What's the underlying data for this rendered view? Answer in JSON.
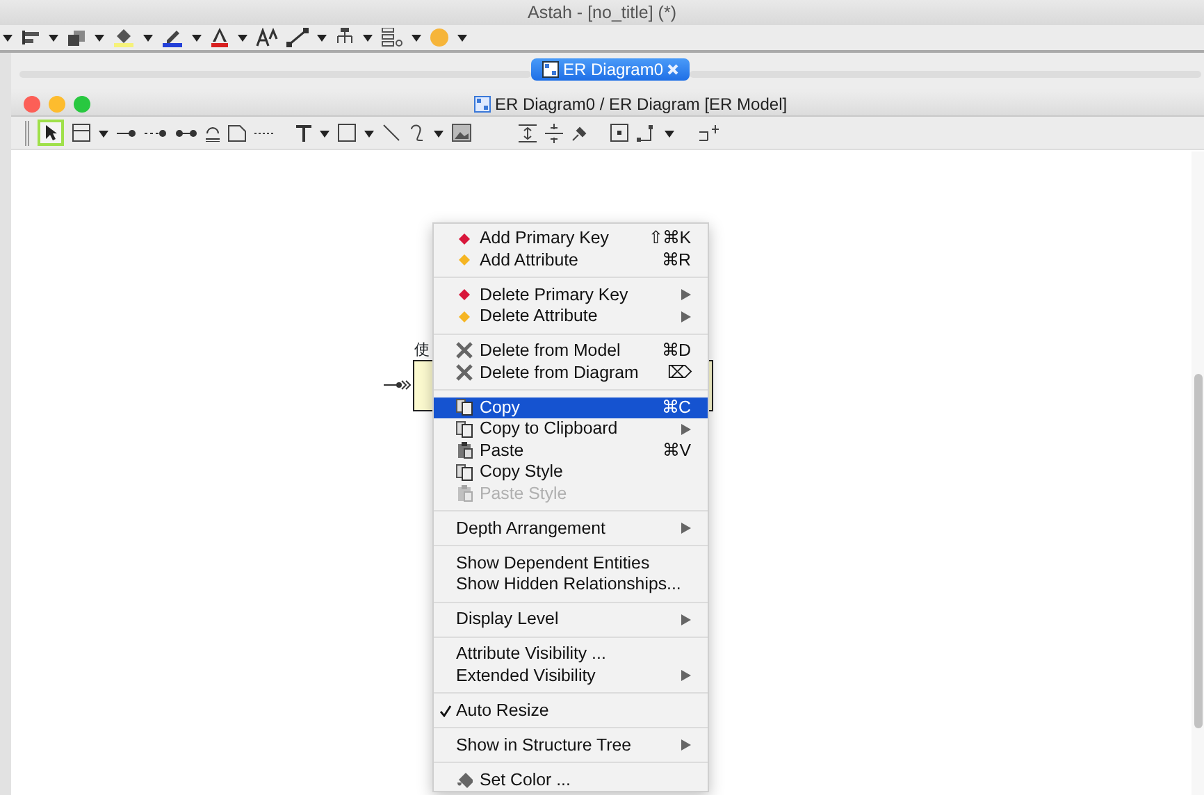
{
  "window": {
    "title": "Astah - [no_title] (*)"
  },
  "tabs": [
    {
      "label": "ER Diagram0",
      "selected": true
    }
  ],
  "diagram_window": {
    "title": "ER Diagram0 / ER Diagram [ER Model]"
  },
  "canvas": {
    "entity": {
      "label": "使"
    }
  },
  "context_menu": {
    "sections": [
      [
        {
          "label": "Add Primary Key",
          "kind": "primary-key",
          "shortcut": "⇧⌘K",
          "submenu": false,
          "selected": false,
          "disabled": false,
          "checked": false
        },
        {
          "label": "Add Attribute",
          "kind": "attribute",
          "shortcut": "⌘R",
          "submenu": false,
          "selected": false,
          "disabled": false,
          "checked": false
        }
      ],
      [
        {
          "label": "Delete Primary Key",
          "kind": "primary-key",
          "submenu": true,
          "selected": false,
          "disabled": false,
          "checked": false
        },
        {
          "label": "Delete Attribute",
          "kind": "attribute",
          "submenu": true,
          "selected": false,
          "disabled": false,
          "checked": false
        }
      ],
      [
        {
          "label": "Delete from Model",
          "kind": "delete",
          "shortcut": "⌘D",
          "submenu": false,
          "selected": false,
          "disabled": false,
          "checked": false
        },
        {
          "label": "Delete from Diagram",
          "kind": "delete",
          "shortcut": "⌦",
          "submenu": false,
          "selected": false,
          "disabled": false,
          "checked": false
        }
      ],
      [
        {
          "label": "Copy",
          "kind": "copy",
          "shortcut": "⌘C",
          "submenu": false,
          "selected": true,
          "disabled": false,
          "checked": false
        },
        {
          "label": "Copy to Clipboard",
          "kind": "copy",
          "submenu": true,
          "selected": false,
          "disabled": false,
          "checked": false
        },
        {
          "label": "Paste",
          "kind": "paste",
          "shortcut": "⌘V",
          "submenu": false,
          "selected": false,
          "disabled": false,
          "checked": false
        },
        {
          "label": "Copy Style",
          "kind": "copy",
          "submenu": false,
          "selected": false,
          "disabled": false,
          "checked": false
        },
        {
          "label": "Paste Style",
          "kind": "paste",
          "submenu": false,
          "selected": false,
          "disabled": true,
          "checked": false
        }
      ],
      [
        {
          "label": "Depth Arrangement",
          "kind": "plain",
          "submenu": true,
          "selected": false,
          "disabled": false,
          "checked": false
        }
      ],
      [
        {
          "label": "Show Dependent Entities",
          "kind": "plain",
          "submenu": false,
          "selected": false,
          "disabled": false,
          "checked": false
        },
        {
          "label": "Show Hidden Relationships...",
          "kind": "plain",
          "submenu": false,
          "selected": false,
          "disabled": false,
          "checked": false
        }
      ],
      [
        {
          "label": "Display Level",
          "kind": "plain",
          "submenu": true,
          "selected": false,
          "disabled": false,
          "checked": false
        }
      ],
      [
        {
          "label": "Attribute Visibility ...",
          "kind": "plain",
          "submenu": false,
          "selected": false,
          "disabled": false,
          "checked": false
        },
        {
          "label": "Extended Visibility",
          "kind": "plain",
          "submenu": true,
          "selected": false,
          "disabled": false,
          "checked": false
        }
      ],
      [
        {
          "label": "Auto Resize",
          "kind": "plain",
          "submenu": false,
          "selected": false,
          "disabled": false,
          "checked": true
        }
      ],
      [
        {
          "label": "Show in Structure Tree",
          "kind": "plain",
          "submenu": true,
          "selected": false,
          "disabled": false,
          "checked": false
        }
      ],
      [
        {
          "label": "Set Color ...",
          "kind": "paint",
          "submenu": false,
          "selected": false,
          "disabled": false,
          "checked": false
        }
      ]
    ]
  }
}
